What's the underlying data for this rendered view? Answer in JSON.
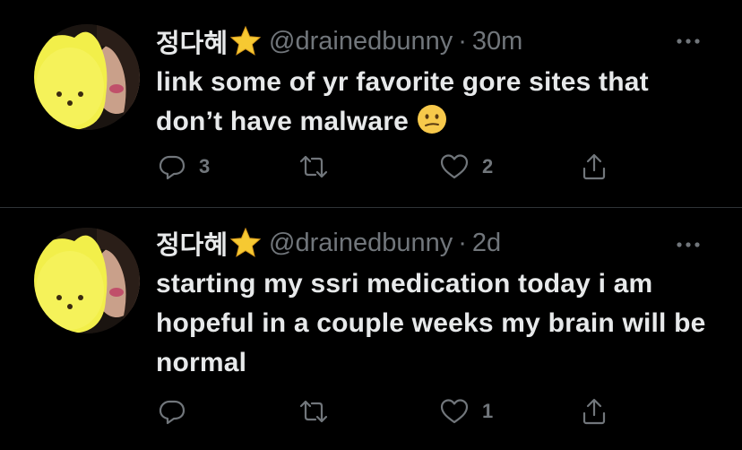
{
  "tweets": [
    {
      "display_name": "정다혜",
      "handle": "@drainedbunny",
      "separator": "·",
      "time": "30m",
      "text": "link some of yr favorite gore sites that don’t have malware",
      "emoji": "confused-face-emoji",
      "replies": "3",
      "retweets": "",
      "likes": "2"
    },
    {
      "display_name": "정다혜",
      "handle": "@drainedbunny",
      "separator": "·",
      "time": "2d",
      "text": "starting my ssri medication today i am hopeful in a couple weeks my brain will be normal",
      "emoji": "",
      "replies": "",
      "retweets": "",
      "likes": "1"
    }
  ],
  "colors": {
    "background": "#000000",
    "text": "#e7e9ea",
    "muted": "#71767b",
    "divider": "#2f3336",
    "star": "#f6c932"
  }
}
